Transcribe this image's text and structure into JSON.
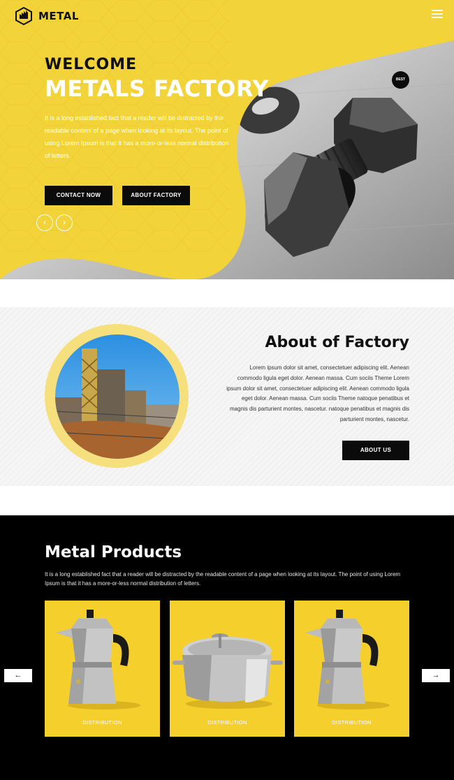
{
  "header": {
    "logo_text": "METAL",
    "menu_icon": "hamburger-icon"
  },
  "hero": {
    "welcome": "WELCOME",
    "title": "METALS FACTORY",
    "description": "It is a long established fact that a reader will be distracted by the readable content of a page when looking at its layout. The point of using Lorem Ipsum is that it has a more-or-less normal distribution of letters.",
    "contact_label": "CONTACT NOW",
    "about_factory_label": "ABOUT FACTORY",
    "prev_icon": "chevron-left-icon",
    "next_icon": "chevron-right-icon",
    "badge": "BEST"
  },
  "about": {
    "title": "About of Factory",
    "text": "Lorem ipsum dolor sit amet, consectetuer adipiscing elit. Aenean commodo ligula eget dolor. Aenean massa. Cum sociis Theme Lorem ipsum dolor sit amet, consectetuer adipiscing elit. Aenean commodo ligula eget dolor. Aenean massa. Cum sociis Theme natoque penatibus et magnis dis parturient montes, nascetur. natoque penatibus et magnis dis parturient montes, nascetur.",
    "button_label": "ABOUT US"
  },
  "products": {
    "title": "Metal Products",
    "description": "It is a long established fact that a reader will be distracted by the readable content of a page when looking at its layout. The point of using Lorem Ipsum is that it has a more-or-less normal distribution of letters.",
    "items": [
      {
        "label": "DISTRIBUTION",
        "image": "moka-pot"
      },
      {
        "label": "DISTRIBUTION",
        "image": "cooking-pot"
      },
      {
        "label": "DISTRIBUTION",
        "image": "moka-pot"
      }
    ],
    "prev_arrow": "←",
    "next_arrow": "→"
  },
  "colors": {
    "accent_yellow": "#f5cf2c",
    "dark": "#0b0b0b",
    "white": "#ffffff"
  }
}
